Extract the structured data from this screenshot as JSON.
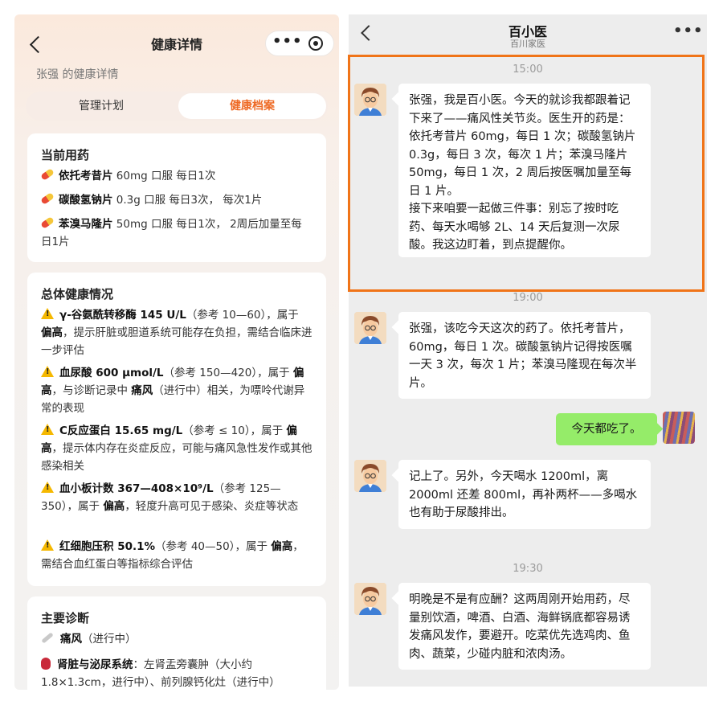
{
  "left": {
    "title": "健康详情",
    "capsule_more": "•••",
    "subtitle": "张强 的健康详情",
    "tabs": [
      {
        "label": "管理计划",
        "active": false
      },
      {
        "label": "健康档案",
        "active": true
      }
    ],
    "medications": {
      "title": "当前用药",
      "items": [
        {
          "name": "依托考昔片",
          "detail": " 60mg 口服 每日1次"
        },
        {
          "name": "碳酸氢钠片",
          "detail": " 0.3g 口服 每日3次， 每次1片"
        },
        {
          "name": "苯溴马隆片",
          "detail": " 50mg 口服 每日1次， 2周后加量至每日1片"
        }
      ]
    },
    "health": {
      "title": "总体健康情况",
      "items": [
        {
          "name": "γ-谷氨酰转移酶 145 U/L",
          "pre": "（参考 10—60），属于 ",
          "flag": "偏高",
          "post": "，提示肝脏或胆道系统可能存在负担，需结合临床进一步评估"
        },
        {
          "name": "血尿酸 600 μmol/L",
          "pre": "（参考 150—420），属于 ",
          "flag": "偏高",
          "mid": "，与诊断记录中 ",
          "diag": "痛风",
          "post": "（进行中）相关，为嘌呤代谢异常的表现"
        },
        {
          "name": "C反应蛋白 15.65 mg/L",
          "pre": "（参考 ≤ 10），属于 ",
          "flag": "偏高",
          "post": "，提示体内存在炎症反应，可能与痛风急性发作或其他感染相关"
        },
        {
          "name": "血小板计数 367—408×10⁹/L",
          "pre": "（参考 125—350），属于 ",
          "flag": "偏高",
          "post": "，轻度升高可见于感染、炎症等状态"
        },
        {
          "name": "红细胞压积 50.1%",
          "pre": "（参考 40—50），属于 ",
          "flag": "偏高",
          "post": "，需结合血红蛋白等指标综合评估"
        }
      ]
    },
    "diagnosis": {
      "title": "主要诊断",
      "items": [
        {
          "name": "痛风",
          "detail": "（进行中）",
          "icon": "bone-icon"
        },
        {
          "name": "肾脏与泌尿系统",
          "detail": "：左肾盂旁囊肿（大小约 1.8×1.3cm，进行中）、前列腺钙化灶（进行中）",
          "icon": "kidney-icon"
        }
      ]
    }
  },
  "right": {
    "title": "百小医",
    "subtitle": "百川家医",
    "more": "•••",
    "messages": [
      {
        "time": "15:00",
        "text": "张强，我是百小医。今天的就诊我都跟着记下来了——痛风性关节炎。医生开的药是：依托考昔片 60mg，每日 1 次；碳酸氢钠片 0.3g，每日 3 次，每次 1 片；苯溴马隆片 50mg，每日 1 次，2 周后按医嘱加量至每日 1 片。\n接下来咱要一起做三件事：别忘了按时吃药、每天水喝够 2L、14 天后复测一次尿酸。我这边盯着，到点提醒你。"
      },
      {
        "time": "19:00",
        "text": "张强，该吃今天这次的药了。依托考昔片，60mg，每日 1 次。碳酸氢钠片记得按医嘱一天 3 次，每次 1 片；苯溴马隆现在每次半片。"
      },
      {
        "user_text": "今天都吃了。"
      },
      {
        "text": "记上了。另外，今天喝水 1200ml，离 2000ml 还差 800ml，再补两杯——多喝水也有助于尿酸排出。"
      },
      {
        "time": "19:30",
        "text": "明晚是不是有应酬？这两周刚开始用药，尽量别饮酒，啤酒、白酒、海鲜锅底都容易诱发痛风发作，要避开。吃菜优先选鸡肉、鱼肉、蔬菜，少碰内脏和浓肉汤。"
      }
    ]
  },
  "colors": {
    "accent": "#ee6a25",
    "highlight": "#f07418",
    "user_bubble": "#95ec69",
    "warning": "#f5b800"
  }
}
